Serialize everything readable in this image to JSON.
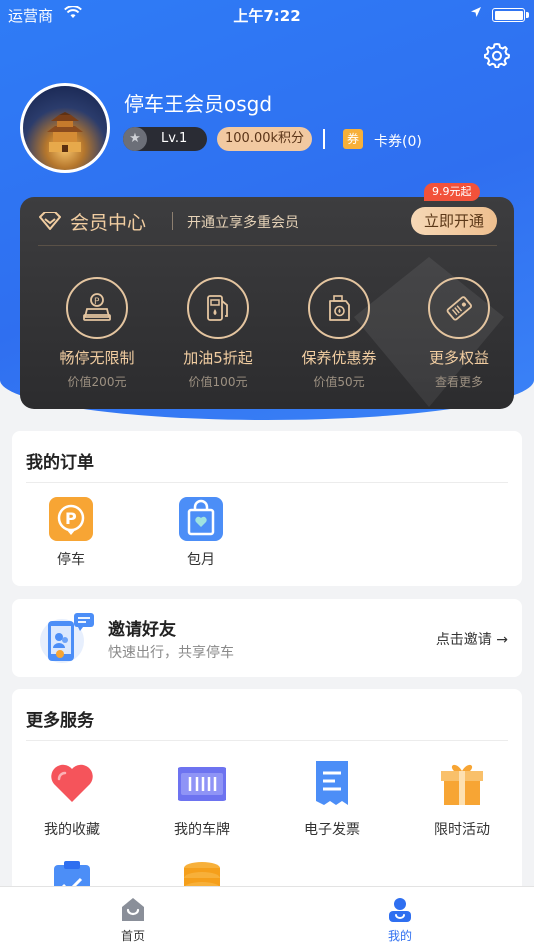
{
  "status_bar": {
    "carrier": "运营商",
    "time": "上午7:22"
  },
  "profile": {
    "username": "停车王会员osgd",
    "level": "Lv.1",
    "points": "100.00k积分",
    "coupon_icon": "券",
    "coupons": "卡券(0)"
  },
  "vip": {
    "badge": "9.9元起",
    "title": "会员中心",
    "subtitle": "开通立享多重会员",
    "button": "立即开通",
    "benefits": [
      {
        "title": "畅停无限制",
        "sub": "价值200元",
        "icon": "parking-car-icon"
      },
      {
        "title": "加油5折起",
        "sub": "价值100元",
        "icon": "fuel-pump-icon"
      },
      {
        "title": "保养优惠券",
        "sub": "价值50元",
        "icon": "oil-can-icon"
      },
      {
        "title": "更多权益",
        "sub": "查看更多",
        "icon": "ticket-icon"
      }
    ]
  },
  "orders": {
    "title": "我的订单",
    "items": [
      {
        "label": "停车",
        "icon": "parking-p-icon",
        "color": "#f7a534"
      },
      {
        "label": "包月",
        "icon": "shopping-bag-icon",
        "color": "#4c8ef7"
      }
    ]
  },
  "invite": {
    "title": "邀请好友",
    "subtitle": "快速出行，共享停车",
    "link": "点击邀请 →"
  },
  "services": {
    "title": "更多服务",
    "items": [
      {
        "label": "我的收藏",
        "icon": "heart-icon",
        "color": "#f5545b"
      },
      {
        "label": "我的车牌",
        "icon": "license-plate-icon",
        "color": "#6d73f0"
      },
      {
        "label": "电子发票",
        "icon": "invoice-icon",
        "color": "#4c8ef7"
      },
      {
        "label": "限时活动",
        "icon": "gift-icon",
        "color": "#f7a534"
      }
    ]
  },
  "tabbar": {
    "home": "首页",
    "mine": "我的",
    "active_color": "#2f6ff0"
  }
}
